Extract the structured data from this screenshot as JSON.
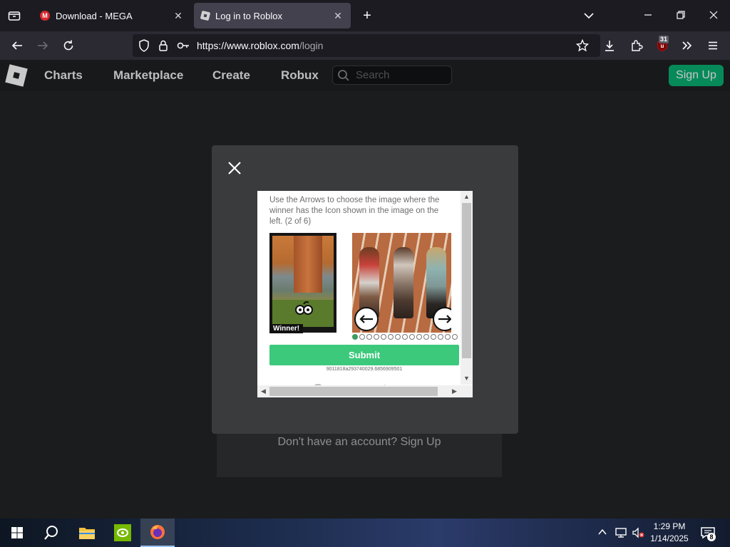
{
  "browser": {
    "tabs": [
      {
        "title": "Download - MEGA",
        "favicon": "mega-icon",
        "active": false
      },
      {
        "title": "Log in to Roblox",
        "favicon": "roblox-icon",
        "active": true
      }
    ],
    "url_host": "https://www.roblox.com",
    "url_path": "/login",
    "extension_badge": "31"
  },
  "roblox_header": {
    "nav": [
      "Charts",
      "Marketplace",
      "Create",
      "Robux"
    ],
    "search_placeholder": "Search",
    "signup_label": "Sign Up"
  },
  "page": {
    "no_account_text": "Don't have an account? Sign Up"
  },
  "captcha": {
    "instructions": "Use the Arrows to choose the image where the winner has the Icon shown in the image on the left. (2 of 6)",
    "example_label": "Winner!",
    "submit_label": "Submit",
    "session_id": "9011818a293740029.6856909501",
    "total_dots": 15,
    "active_dot": 0
  },
  "taskbar": {
    "apps": [
      "windows-start",
      "search",
      "file-explorer",
      "nvidia",
      "firefox"
    ],
    "time": "1:29 PM",
    "date": "1/14/2025",
    "notification_count": "8"
  },
  "colors": {
    "roblox_green": "#00b06f",
    "submit_green": "#3cc97c",
    "tab_active": "#42414d"
  }
}
